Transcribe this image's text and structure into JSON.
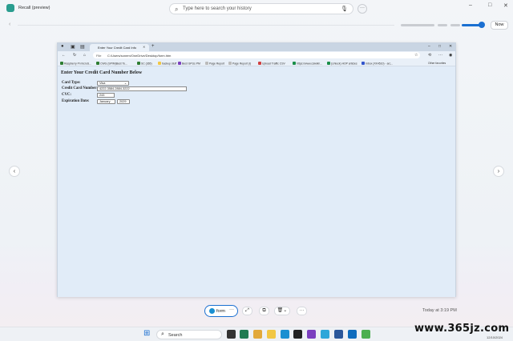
{
  "recall": {
    "title": "Recall (preview)",
    "search_placeholder": "Type here to search your history",
    "more_label": "···",
    "now_label": "Now",
    "win_minimize": "–",
    "win_maximize": "□",
    "win_close": "✕",
    "nav_prev": "‹",
    "nav_next": "›",
    "timeline_back": "‹"
  },
  "browser": {
    "tab_title": "Enter Your Credit Card Info",
    "tab_close": "✕",
    "tab_plus": "+",
    "address_label": "File",
    "address_url": "C:/Users/sonem/OneDrive/Desktop/form.htm",
    "win_min": "–",
    "win_max": "□",
    "win_close": "✕",
    "bookmarks": [
      {
        "label": "Raspberry Pi microS...",
        "color": "#2e7d32"
      },
      {
        "label": "CWG (SPIM)Best To...",
        "color": "#2e7d32"
      },
      {
        "label": "SC (365)",
        "color": "#2e7d32"
      },
      {
        "label": "backup stuff",
        "color": "#f2c744"
      },
      {
        "label": "Best GPUs PM",
        "color": "#7b3fbf"
      },
      {
        "label": "Page Report",
        "color": "#bbbbbb"
      },
      {
        "label": "Page Report (I)",
        "color": "#bbbbbb"
      },
      {
        "label": "Upload Traffic CSV",
        "color": "#d04040"
      },
      {
        "label": "https://www.csiwiki/...",
        "color": "#1a8f4a"
      },
      {
        "label": "(Unlock) HOP articles",
        "color": "#1a8f4a"
      },
      {
        "label": "Inbox (XK4510) - arc...",
        "color": "#3355cc"
      }
    ],
    "other_favorites": "Other favorites"
  },
  "form": {
    "heading": "Enter Your Credit Card Number Below",
    "card_type_label": "Card Type:",
    "card_type_value": "Visa",
    "card_number_label": "Credit Card Number:",
    "card_number_value": "4222-3584-2884-3222",
    "cvc_label": "CVC:",
    "cvc_value": "243",
    "exp_label": "Expiration Date:",
    "exp_month": "January",
    "exp_year": "2029"
  },
  "toolbar": {
    "snapshot_label": "form",
    "more": "···",
    "timestamp": "Today at 3:19 PM"
  },
  "taskbar": {
    "search_placeholder": "Search",
    "date": "12/10/2024"
  },
  "watermark": "www.365jz.com"
}
